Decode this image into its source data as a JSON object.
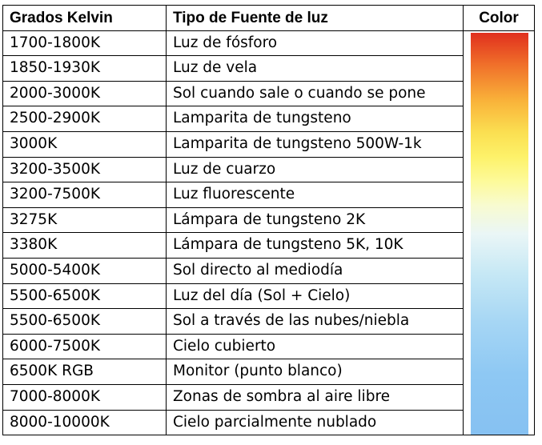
{
  "headers": {
    "kelvin": "Grados Kelvin",
    "source": "Tipo de Fuente de luz",
    "color": "Color"
  },
  "rows": [
    {
      "kelvin": "1700-1800K",
      "source": "Luz de fósforo"
    },
    {
      "kelvin": "1850-1930K",
      "source": "Luz de vela"
    },
    {
      "kelvin": "2000-3000K",
      "source": "Sol cuando sale o cuando se pone"
    },
    {
      "kelvin": "2500-2900K",
      "source": "Lamparita de tungsteno"
    },
    {
      "kelvin": "3000K",
      "source": "Lamparita de tungsteno 500W-1k"
    },
    {
      "kelvin": "3200-3500K",
      "source": "Luz de cuarzo"
    },
    {
      "kelvin": "3200-7500K",
      "source": "Luz fluorescente"
    },
    {
      "kelvin": "3275K",
      "source": "Lámpara de tungsteno 2K"
    },
    {
      "kelvin": "3380K",
      "source": "Lámpara de tungsteno 5K, 10K"
    },
    {
      "kelvin": "5000-5400K",
      "source": "Sol directo al mediodía"
    },
    {
      "kelvin": "5500-6500K",
      "source": "Luz del día (Sol + Cielo)"
    },
    {
      "kelvin": "5500-6500K",
      "source": "Sol a través de las nubes/niebla"
    },
    {
      "kelvin": "6000-7500K",
      "source": "Cielo cubierto"
    },
    {
      "kelvin": "6500K RGB",
      "source": "Monitor (punto blanco)"
    },
    {
      "kelvin": "7000-8000K",
      "source": "Zonas de sombra al aire libre"
    },
    {
      "kelvin": "8000-10000K",
      "source": "Cielo parcialmente nublado"
    }
  ],
  "color_bar": {
    "top_color": "#e0301e",
    "middle_color": "#fdf26a",
    "bottom_color": "#86c1f2"
  }
}
